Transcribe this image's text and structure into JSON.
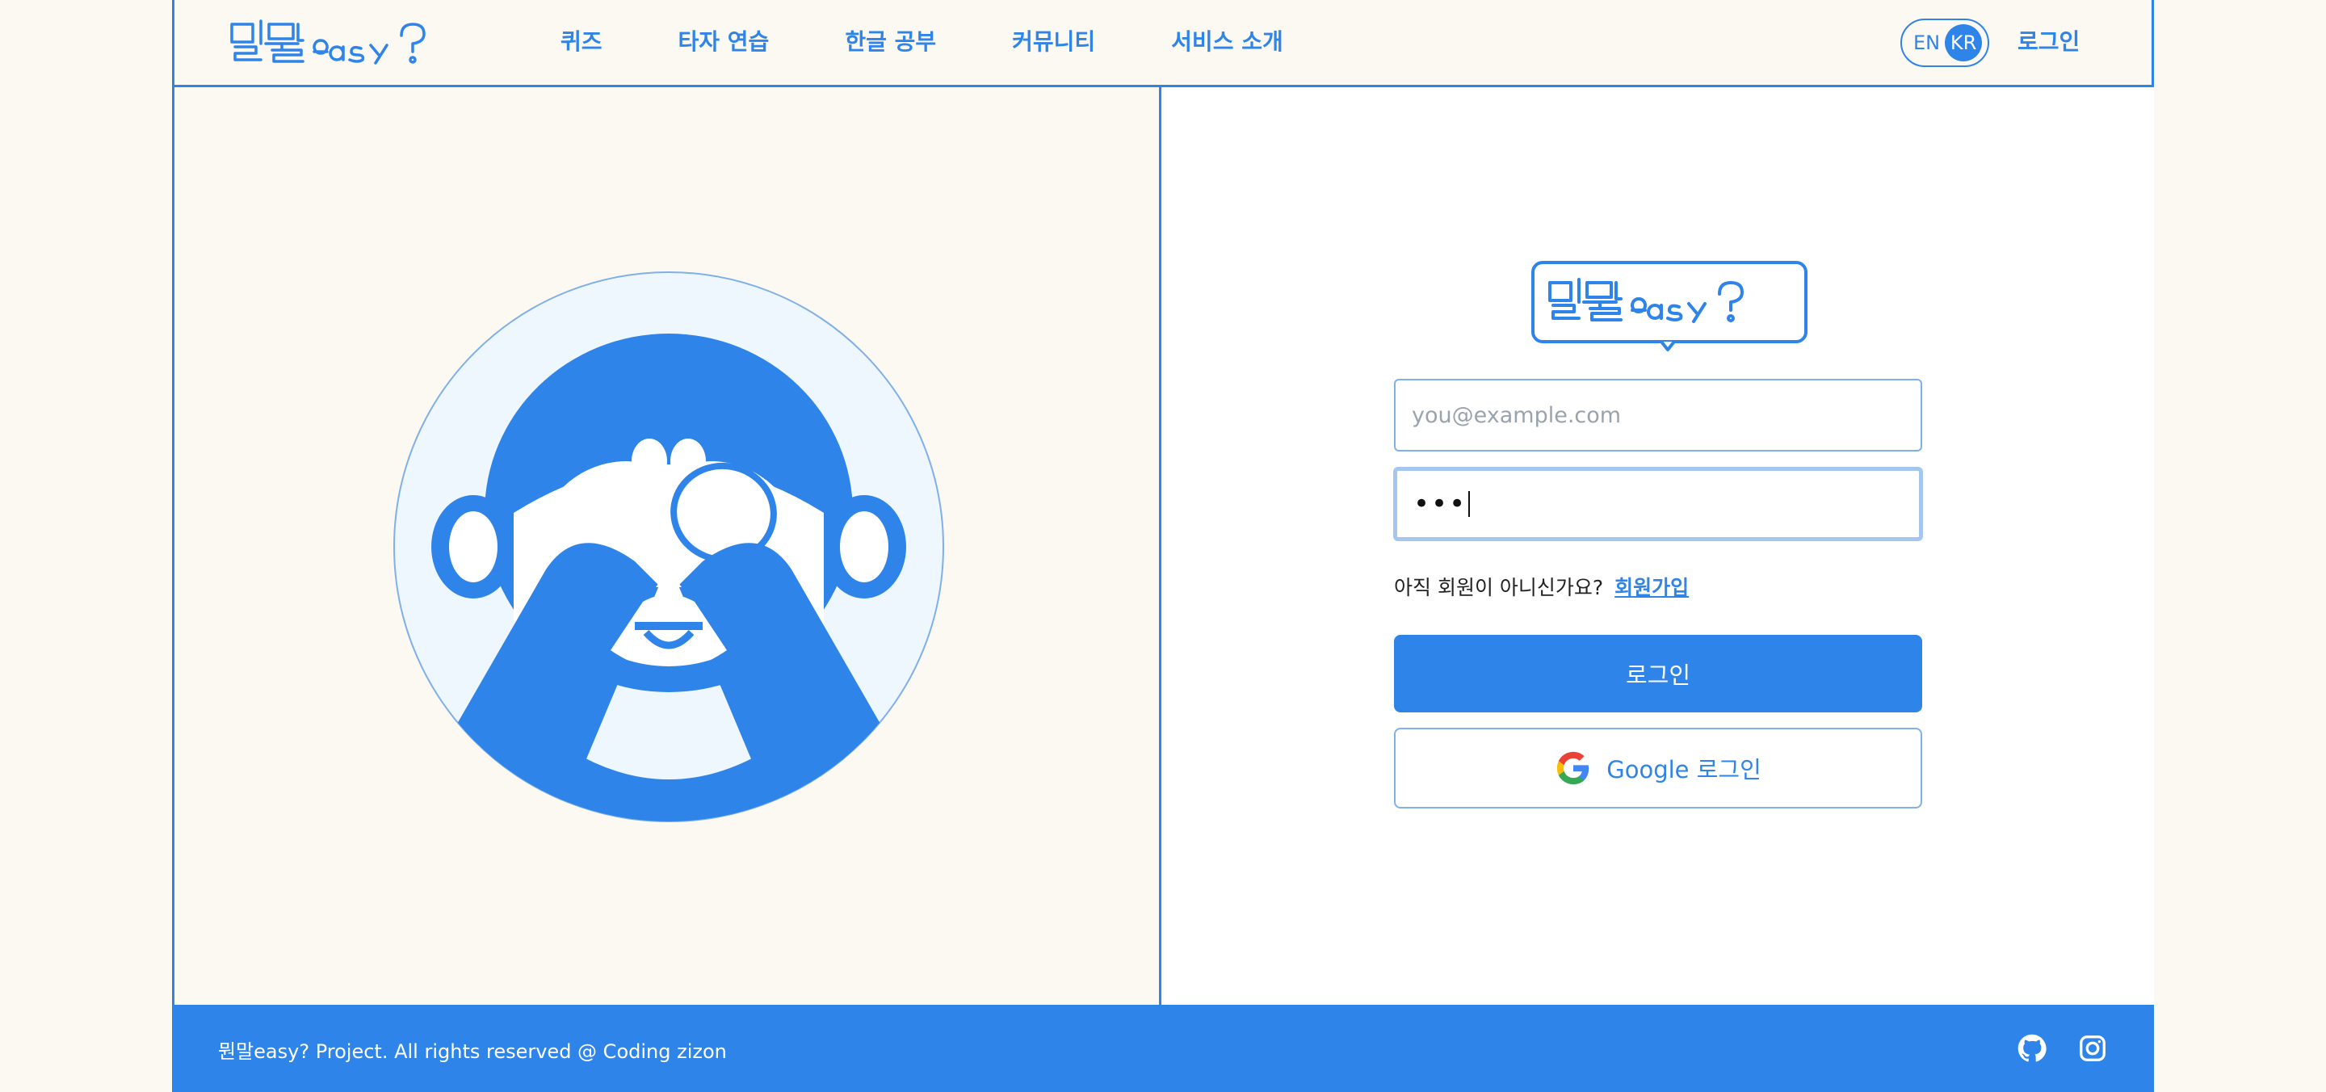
{
  "brand": {
    "logo_alt": "뭔말easy?"
  },
  "nav": {
    "items": [
      {
        "label": "퀴즈"
      },
      {
        "label": "타자 연습"
      },
      {
        "label": "한글 공부"
      },
      {
        "label": "커뮤니티"
      },
      {
        "label": "서비스 소개"
      }
    ]
  },
  "header": {
    "lang_en": "EN",
    "lang_kr": "KR",
    "login_label": "로그인"
  },
  "login_form": {
    "email_placeholder": "you@example.com",
    "email_value": "",
    "password_masked": "•••",
    "signup_prompt": "아직 회원이 아니신가요?",
    "signup_link": "회원가입",
    "login_button": "로그인",
    "google_button": "Google 로그인"
  },
  "footer": {
    "copyright": "뭔말easy? Project. All rights reserved @ Coding zizon",
    "icons": [
      "github-icon",
      "instagram-icon"
    ]
  },
  "colors": {
    "accent": "#2e84e8",
    "background": "#fcf8f2",
    "mascot_bg": "#eef6fe"
  }
}
